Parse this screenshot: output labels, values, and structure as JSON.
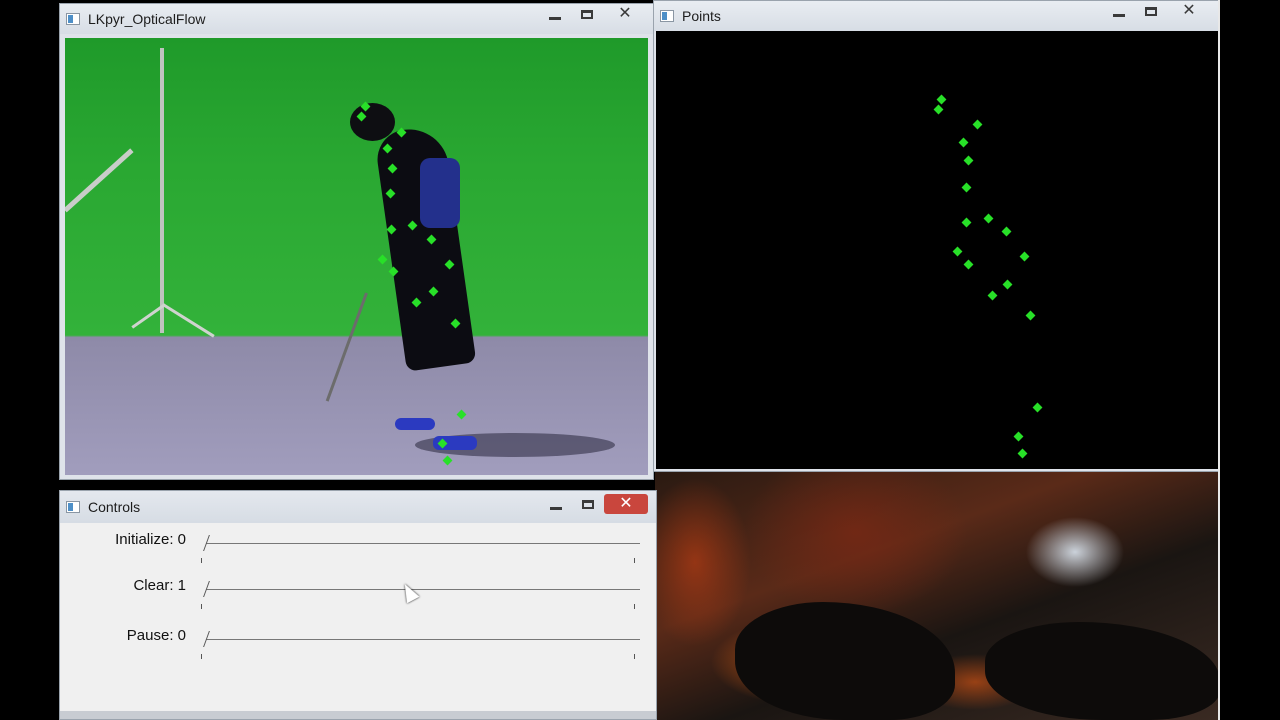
{
  "lk_window": {
    "title": "LKpyr_OpticalFlow",
    "buttons": {
      "minimize": "minimize-icon",
      "maximize": "maximize-icon",
      "close": "✕"
    }
  },
  "points_window": {
    "title": "Points",
    "buttons": {
      "minimize": "minimize-icon",
      "maximize": "maximize-icon",
      "close": "✕"
    }
  },
  "controls_window": {
    "title": "Controls",
    "buttons": {
      "minimize": "minimize-icon",
      "maximize": "maximize-icon",
      "close": "✕"
    },
    "trackbars": [
      {
        "label": "Initialize: 0",
        "value": 0
      },
      {
        "label": "Clear: 1",
        "value": 1
      },
      {
        "label": "Pause: 0",
        "value": 0
      }
    ]
  },
  "colors": {
    "tracking_point": "#28e028",
    "green_screen": "#2aa832",
    "floor": "#a19dbd",
    "points_background": "#000000"
  }
}
